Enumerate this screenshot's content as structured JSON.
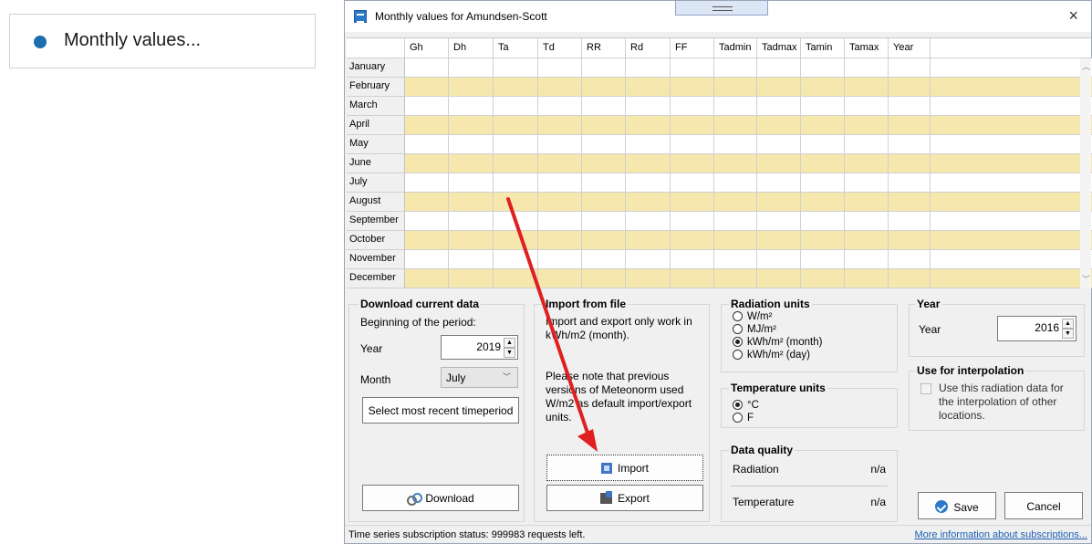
{
  "snippet": {
    "label": "Monthly values..."
  },
  "dialog": {
    "title": "Monthly values for Amundsen-Scott",
    "close": "×"
  },
  "grid": {
    "columns": [
      "Gh",
      "Dh",
      "Ta",
      "Td",
      "RR",
      "Rd",
      "FF",
      "Tadmin",
      "Tadmax",
      "Tamin",
      "Tamax",
      "Year"
    ],
    "months": [
      "January",
      "February",
      "March",
      "April",
      "May",
      "June",
      "July",
      "August",
      "September",
      "October",
      "November",
      "December"
    ]
  },
  "download": {
    "title": "Download current data",
    "period_label": "Beginning of the period:",
    "year_label": "Year",
    "year_value": "2019",
    "month_label": "Month",
    "month_value": "July",
    "recent_button": "Select most recent timeperiod",
    "download_button": "Download"
  },
  "import_file": {
    "title": "Import from file",
    "note1": "Import and export only work in kWh/m2 (month).",
    "note2": "Please note that previous versions of Meteonorm used W/m2 as default import/export units.",
    "import_button": "Import",
    "export_button": "Export"
  },
  "radiation_units": {
    "title": "Radiation units",
    "options": [
      "W/m²",
      "MJ/m²",
      "kWh/m² (month)",
      "kWh/m² (day)"
    ],
    "selected_index": 2
  },
  "temperature_units": {
    "title": "Temperature units",
    "options": [
      "°C",
      "F"
    ],
    "selected_index": 0
  },
  "data_quality": {
    "title": "Data quality",
    "radiation_label": "Radiation",
    "radiation_value": "n/a",
    "temperature_label": "Temperature",
    "temperature_value": "n/a"
  },
  "year_group": {
    "title": "Year",
    "year_label": "Year",
    "year_value": "2016"
  },
  "interpolation": {
    "title": "Use for interpolation",
    "checkbox_label": "Use this radiation data for the interpolation of other locations."
  },
  "actions": {
    "save": "Save",
    "cancel": "Cancel"
  },
  "status": {
    "text": "Time series subscription status:  999983 requests left.",
    "link": "More information about subscriptions..."
  },
  "colors": {
    "odd_row": "#f6e7ad",
    "accent": "#2b79c8",
    "annotation_arrow": "#e02020"
  }
}
